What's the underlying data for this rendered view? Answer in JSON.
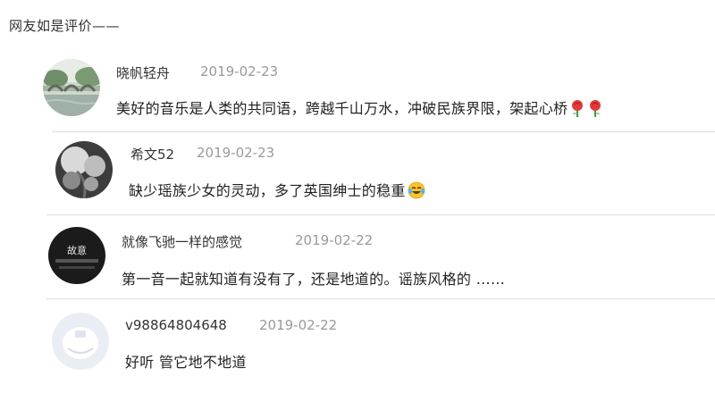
{
  "header": {
    "title": "网友如是评价——"
  },
  "comments": [
    {
      "username": "晓帆轻舟",
      "date": "2019-02-23",
      "text": "美好的音乐是人类的共同语，跨越千山万水，冲破民族界限，架起心桥",
      "emoji": "rose-icon"
    },
    {
      "username": "希文52",
      "date": "2019-02-23",
      "text": "缺少瑶族少女的灵动，多了英国绅士的稳重",
      "emoji": "laughing-crying-icon"
    },
    {
      "username": "就像飞驰一样的感觉",
      "date": "2019-02-22",
      "text": "第一音一起就知道有没有了，还是地道的。谣族风格的 ……",
      "avatar_text": "故意"
    },
    {
      "username": "v98864804648",
      "date": "2019-02-22",
      "text": "好听 管它地不地道"
    }
  ]
}
